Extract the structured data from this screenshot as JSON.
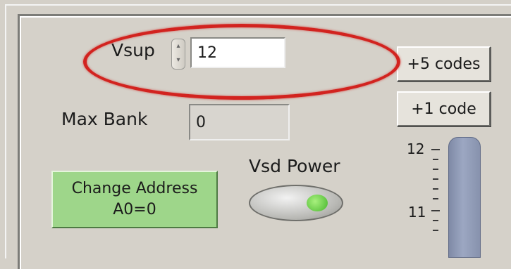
{
  "vsup": {
    "label": "Vsup",
    "value": "12"
  },
  "max_bank": {
    "label": "Max Bank",
    "value": "0"
  },
  "buttons": {
    "plus5": "+5 codes",
    "plus1": "+1 code",
    "change_address_line1": "Change Address",
    "change_address_line2": "A0=0"
  },
  "vsd_power": {
    "label": "Vsd Power",
    "state": "on"
  },
  "slider": {
    "scale": [
      "12",
      "11"
    ]
  },
  "annotation": {
    "color": "#d2231f"
  },
  "colors": {
    "panel": "#d4d0c8",
    "button_green": "#9ed68a",
    "led_green": "#46b62c",
    "slider_blue": "#9ca7c2"
  }
}
